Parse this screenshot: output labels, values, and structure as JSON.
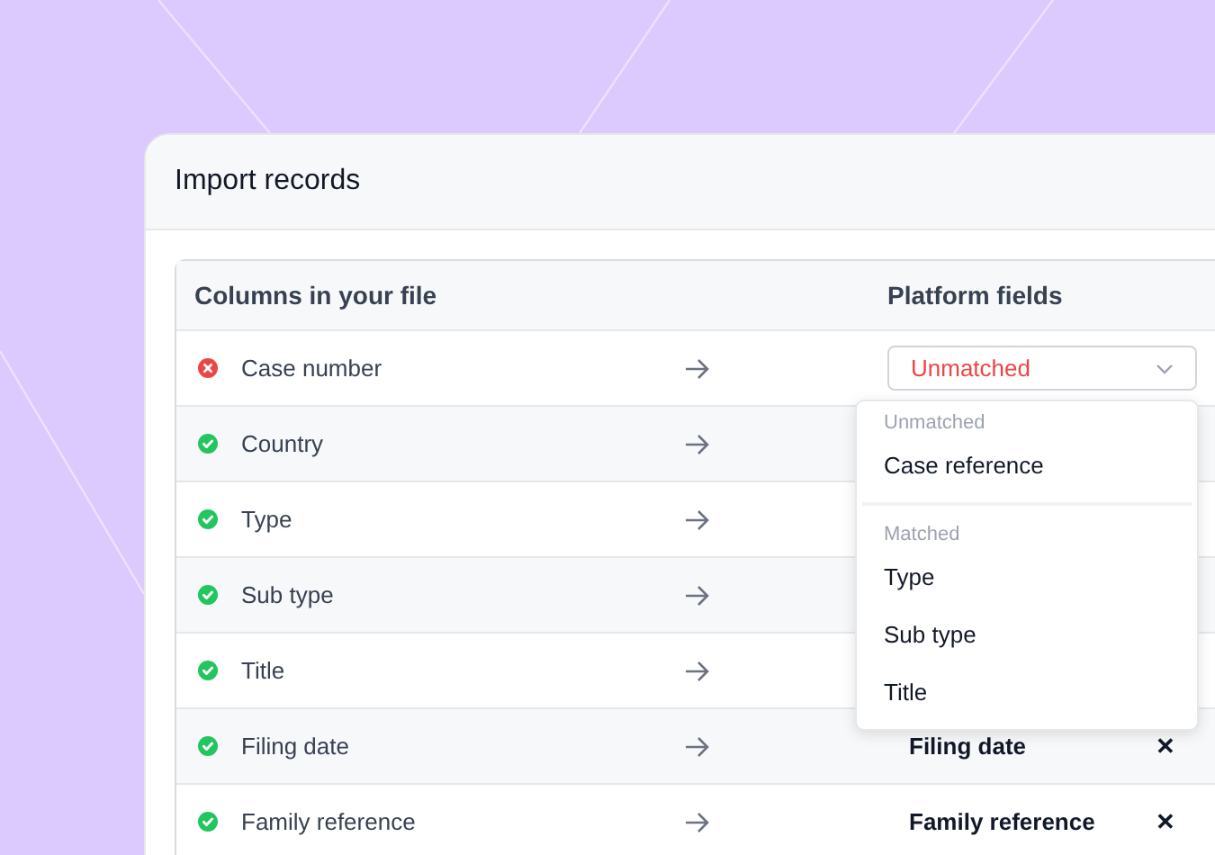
{
  "dialog": {
    "title": "Import records"
  },
  "table": {
    "columns": [
      "Columns in your file",
      "Platform fields"
    ],
    "rows": [
      {
        "column": "Case number",
        "matched": false,
        "field": {
          "kind": "select",
          "value": "Unmatched"
        }
      },
      {
        "column": "Country",
        "matched": true
      },
      {
        "column": "Type",
        "matched": true
      },
      {
        "column": "Sub type",
        "matched": true
      },
      {
        "column": "Title",
        "matched": true
      },
      {
        "column": "Filing date",
        "matched": true,
        "field": {
          "kind": "mapped",
          "value": "Filing date",
          "remove": "✕"
        }
      },
      {
        "column": "Family reference",
        "matched": true,
        "field": {
          "kind": "mapped",
          "value": "Family reference",
          "remove": "✕"
        }
      }
    ]
  },
  "dropdown": {
    "groups": [
      {
        "label": "Unmatched",
        "options": [
          "Case reference"
        ]
      },
      {
        "label": "Matched",
        "options": [
          "Type",
          "Sub type",
          "Title"
        ]
      }
    ]
  }
}
